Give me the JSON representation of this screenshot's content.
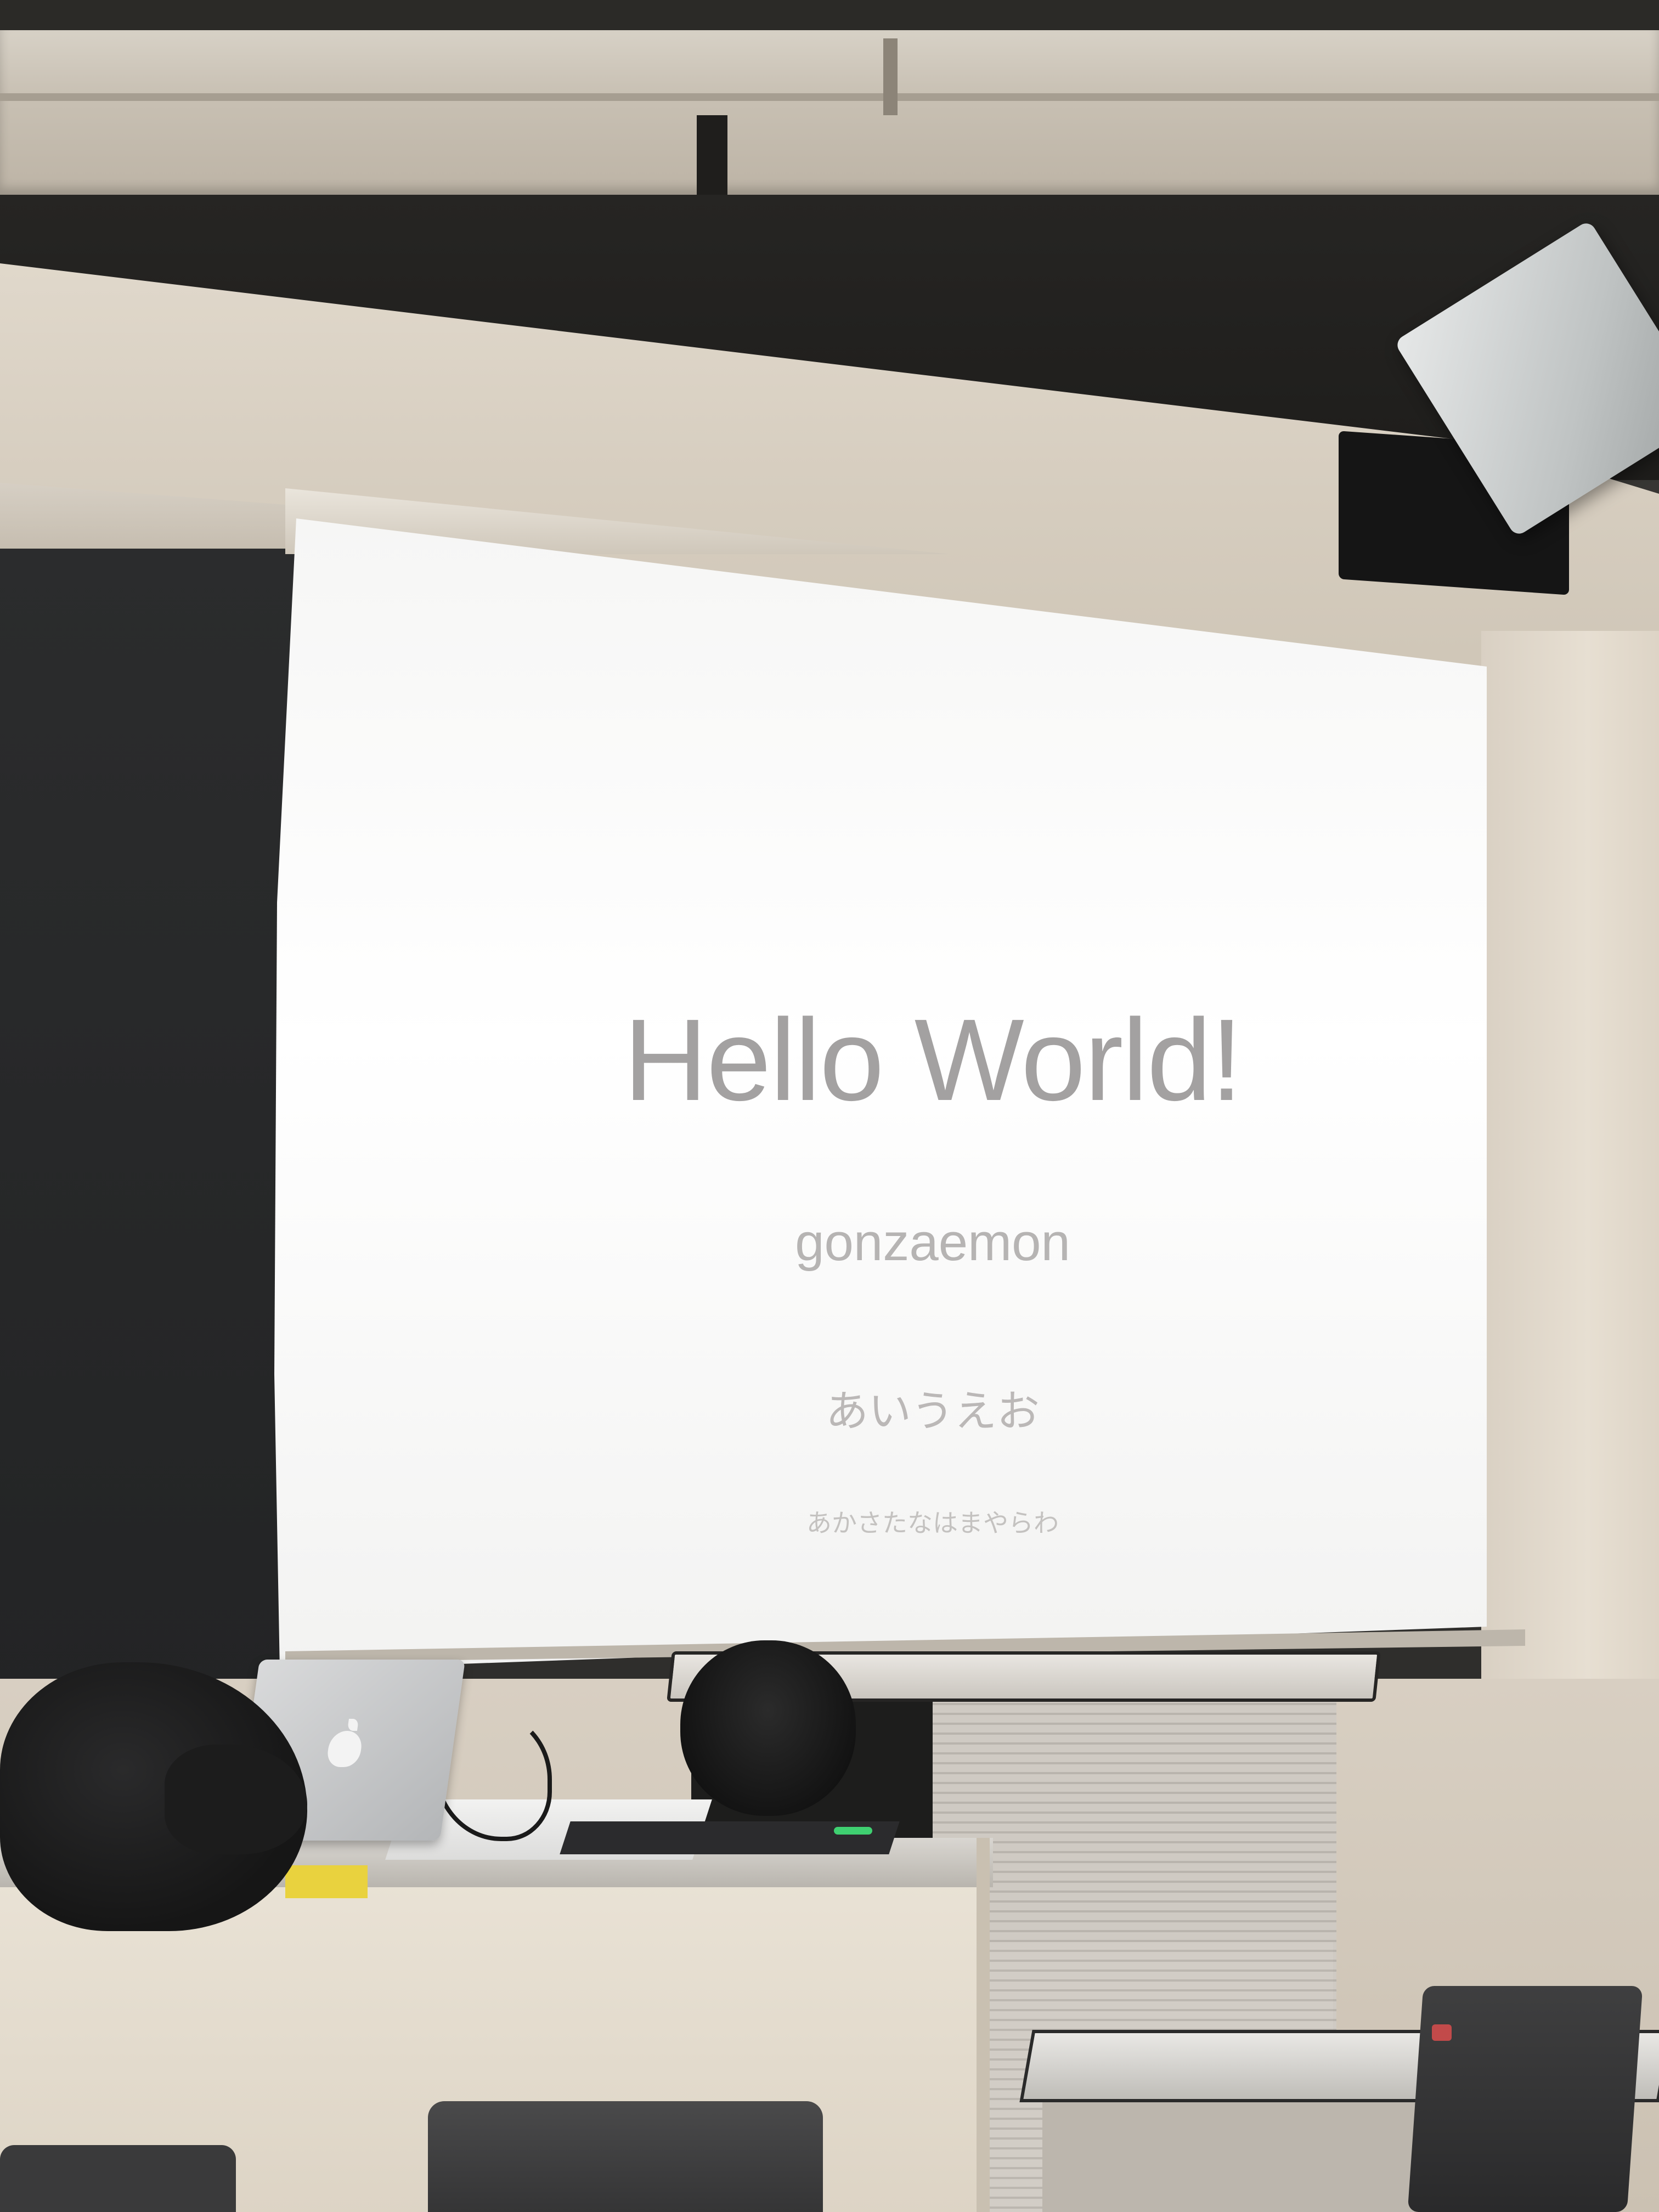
{
  "slide": {
    "title": "Hello World!",
    "author": "gonzaemon",
    "line_1": "あいうえお",
    "line_2": "あかさたなはまやらわ"
  },
  "colors": {
    "screen": "#ffffff",
    "slide_text": "#a9a7a6",
    "wall": "#d8cfc2",
    "blackboard": "#2b2c2d"
  }
}
